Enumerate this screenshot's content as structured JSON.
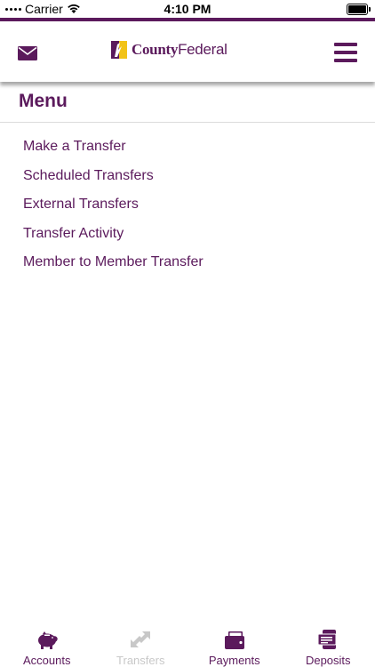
{
  "status_bar": {
    "carrier": "Carrier",
    "time": "4:10 PM"
  },
  "header": {
    "logo_text_bold": "County",
    "logo_text_regular": "Federal",
    "brand_color": "#5b1a5c"
  },
  "menu": {
    "title": "Menu",
    "items": [
      {
        "label": "Make a Transfer"
      },
      {
        "label": "Scheduled Transfers"
      },
      {
        "label": "External Transfers"
      },
      {
        "label": "Transfer Activity"
      },
      {
        "label": "Member to Member Transfer"
      }
    ]
  },
  "tabs": [
    {
      "label": "Accounts",
      "icon": "piggy-bank-icon",
      "state": "enabled"
    },
    {
      "label": "Transfers",
      "icon": "transfer-arrows-icon",
      "state": "disabled"
    },
    {
      "label": "Payments",
      "icon": "wallet-icon",
      "state": "enabled"
    },
    {
      "label": "Deposits",
      "icon": "check-deposit-icon",
      "state": "enabled"
    }
  ],
  "colors": {
    "disabled": "#c8c8c8",
    "divider": "#dcdcdc"
  }
}
